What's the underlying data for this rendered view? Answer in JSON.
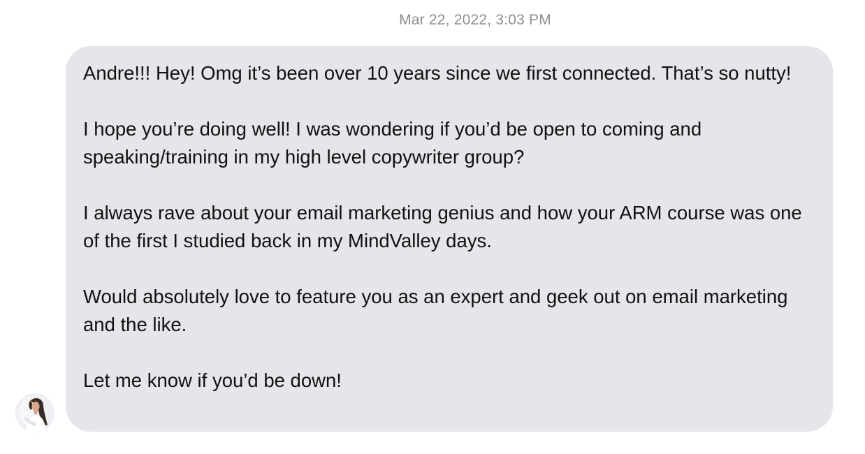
{
  "thread": {
    "timestamp": "Mar 22, 2022, 3:03 PM"
  },
  "message": {
    "sender_avatar_icon": "profile-photo-avatar",
    "bubble_color": "#e5e5ea",
    "paragraphs": [
      "Andre!!! Hey! Omg it’s been over 10 years since we first connected. That’s so nutty!",
      "I hope you’re doing well! I was wondering if you’d be open to coming and speaking/training in my high level copywriter group?",
      "I always rave about your email marketing genius and how your ARM course was one of the first I studied back in my MindValley days.",
      "Would absolutely love to feature you as an expert and geek out on email marketing and the like.",
      "Let me know if you’d be down!"
    ]
  }
}
